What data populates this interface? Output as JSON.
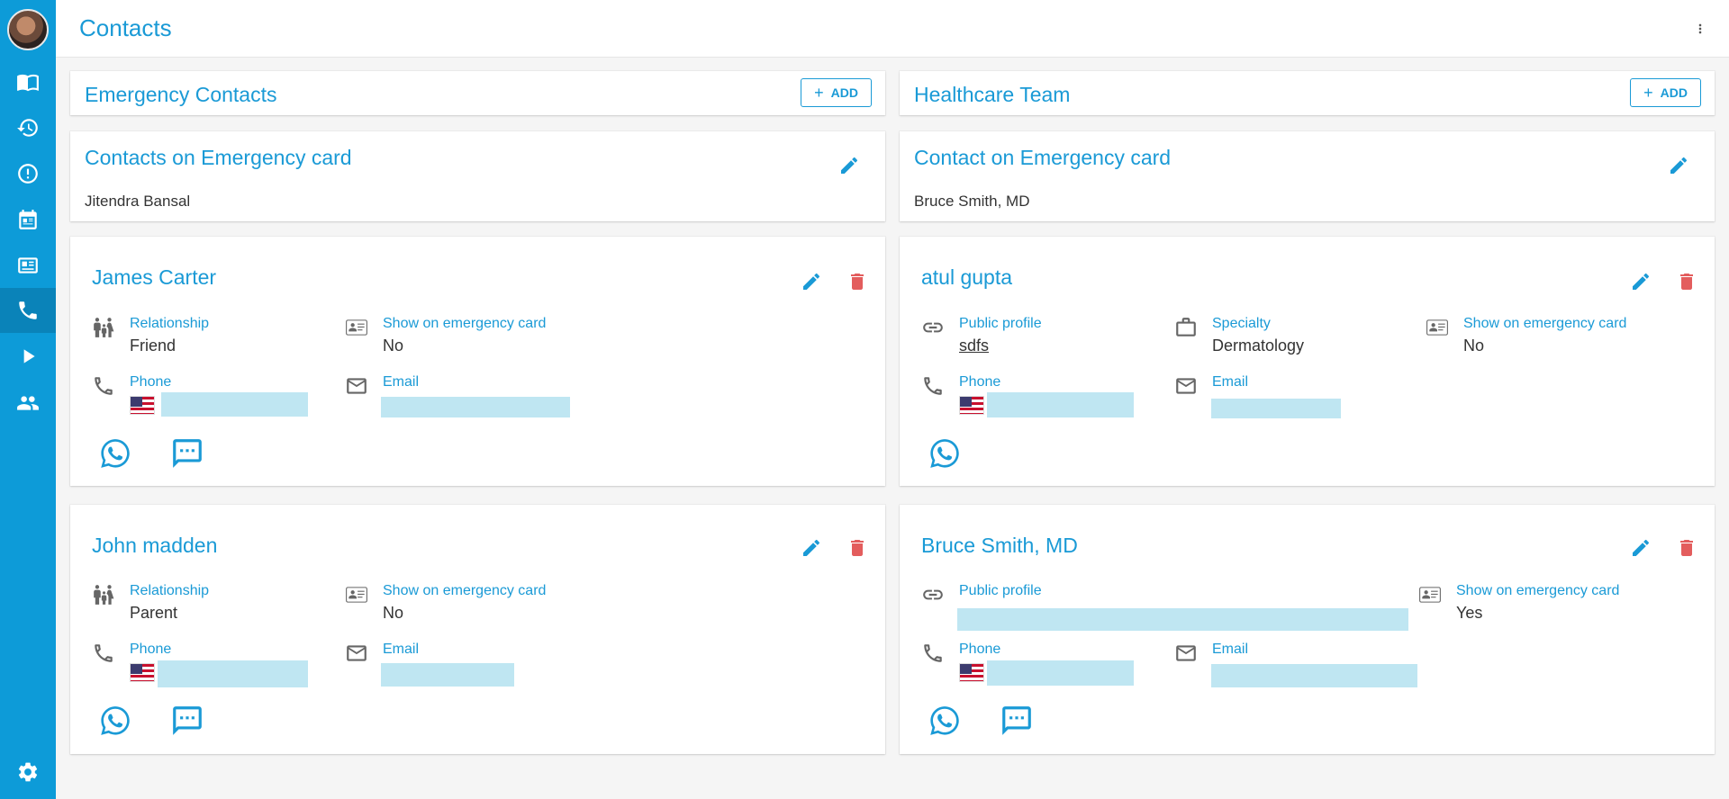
{
  "header": {
    "title": "Contacts"
  },
  "sidebar": {
    "items": [
      {
        "icon": "book-icon",
        "name": "nav-journal"
      },
      {
        "icon": "history-icon",
        "name": "nav-history"
      },
      {
        "icon": "alert-icon",
        "name": "nav-alerts"
      },
      {
        "icon": "calendar-icon",
        "name": "nav-appointments"
      },
      {
        "icon": "id-card-icon",
        "name": "nav-id-card"
      },
      {
        "icon": "phone-icon",
        "name": "nav-contacts",
        "active": true
      },
      {
        "icon": "play-icon",
        "name": "nav-media"
      },
      {
        "icon": "people-icon",
        "name": "nav-people"
      },
      {
        "icon": "gear-icon",
        "name": "nav-settings"
      }
    ]
  },
  "emergency": {
    "title": "Emergency Contacts",
    "add_label": "ADD",
    "card_title": "Contacts on Emergency card",
    "card_value": "Jitendra Bansal",
    "contacts": [
      {
        "name": "James Carter",
        "relationship_label": "Relationship",
        "relationship": "Friend",
        "show_label": "Show on emergency card",
        "show": "No",
        "phone_label": "Phone",
        "email_label": "Email"
      },
      {
        "name": "John madden",
        "relationship_label": "Relationship",
        "relationship": "Parent",
        "show_label": "Show on emergency card",
        "show": "No",
        "phone_label": "Phone",
        "email_label": "Email"
      }
    ]
  },
  "healthcare": {
    "title": "Healthcare Team",
    "add_label": "ADD",
    "card_title": "Contact on Emergency card",
    "card_value": "Bruce Smith, MD",
    "contacts": [
      {
        "name": "atul gupta",
        "profile_label": "Public profile",
        "profile": "sdfs",
        "specialty_label": "Specialty",
        "specialty": "Dermatology",
        "show_label": "Show on emergency card",
        "show": "No",
        "phone_label": "Phone",
        "email_label": "Email"
      },
      {
        "name": "Bruce Smith, MD",
        "profile_label": "Public profile",
        "show_label": "Show on emergency card",
        "show": "Yes",
        "phone_label": "Phone",
        "email_label": "Email"
      }
    ]
  },
  "colors": {
    "accent": "#1a9ad6",
    "sidebar": "#0d9bd8",
    "delete": "#e35d5d",
    "redaction": "#bfe6f2"
  }
}
